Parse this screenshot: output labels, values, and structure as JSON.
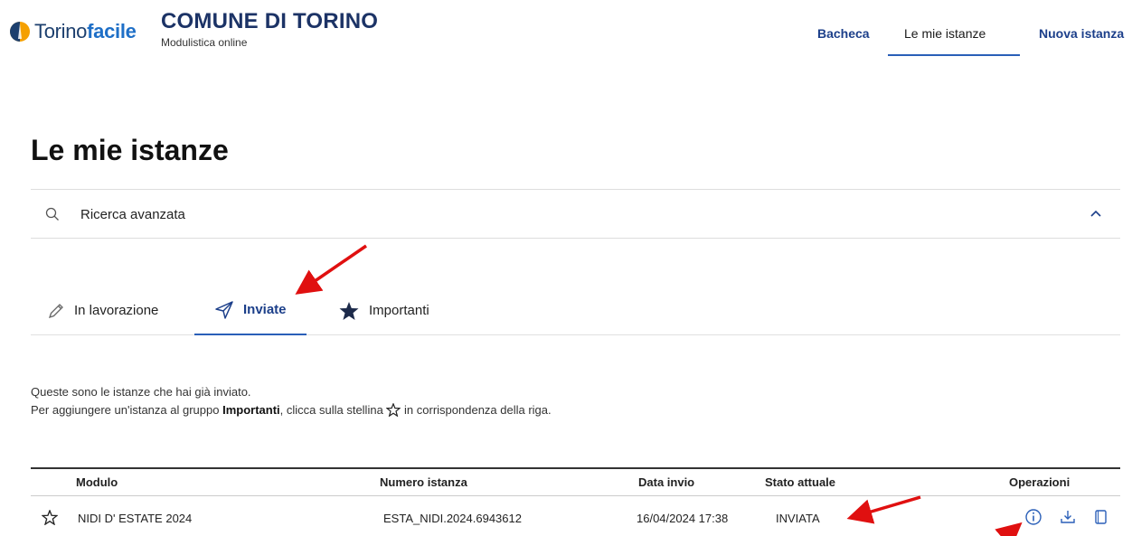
{
  "brand": {
    "logo_prefix": "Torino",
    "logo_suffix": "facile",
    "site_name": "COMUNE DI TORINO",
    "site_subtitle": "Modulistica online"
  },
  "nav": {
    "items": [
      {
        "label": "Bacheca"
      },
      {
        "label": "Le mie istanze"
      },
      {
        "label": "Nuova istanza"
      }
    ],
    "active_index": 1
  },
  "page": {
    "title": "Le mie istanze"
  },
  "search": {
    "label": "Ricerca avanzata"
  },
  "tabs": [
    {
      "label": "In lavorazione",
      "icon": "pencil-icon"
    },
    {
      "label": "Inviate",
      "icon": "send-icon"
    },
    {
      "label": "Importanti",
      "icon": "star-filled-icon"
    }
  ],
  "active_tab": 1,
  "description": {
    "line1": "Queste sono le istanze che hai già inviato.",
    "line2_before": "Per aggiungere un'istanza al gruppo ",
    "line2_bold": "Importanti",
    "line2_mid": ", clicca sulla stellina ",
    "line2_after": " in corrispondenza della riga."
  },
  "table": {
    "columns": [
      "Modulo",
      "Numero istanza",
      "Data invio",
      "Stato attuale",
      "Operazioni"
    ],
    "rows": [
      {
        "modulo": "NIDI D' ESTATE 2024",
        "numero": "ESTA_NIDI.2024.6943612",
        "data": "16/04/2024 17:38",
        "stato": "INVIATA"
      }
    ]
  },
  "colors": {
    "brand_blue": "#1c3f8a",
    "accent_blue": "#2a5fb8",
    "annotation_red": "#e01010"
  }
}
